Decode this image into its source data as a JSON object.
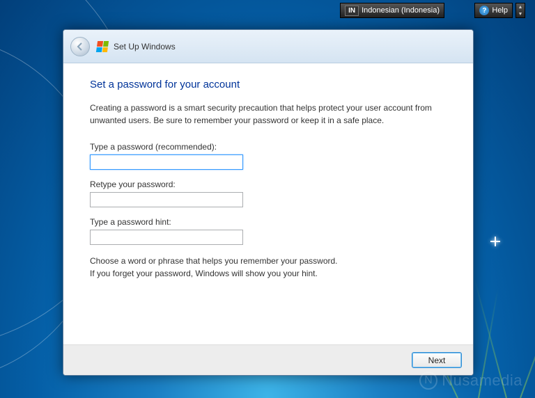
{
  "langbar": {
    "code": "IN",
    "label": "Indonesian (Indonesia)"
  },
  "help": {
    "label": "Help",
    "icon_char": "?"
  },
  "dialog": {
    "header_title": "Set Up Windows",
    "heading": "Set a password for your account",
    "description": "Creating a password is a smart security precaution that helps protect your user account from unwanted users. Be sure to remember your password or keep it in a safe place.",
    "password_label": "Type a password (recommended):",
    "password_value": "",
    "retype_label": "Retype your password:",
    "retype_value": "",
    "hint_label": "Type a password hint:",
    "hint_value": "",
    "hint_description_line1": "Choose a word or phrase that helps you remember your password.",
    "hint_description_line2": "If you forget your password, Windows will show you your hint.",
    "next_button": "Next"
  },
  "watermark": {
    "text": "Nusamedia",
    "icon_char": "N"
  }
}
